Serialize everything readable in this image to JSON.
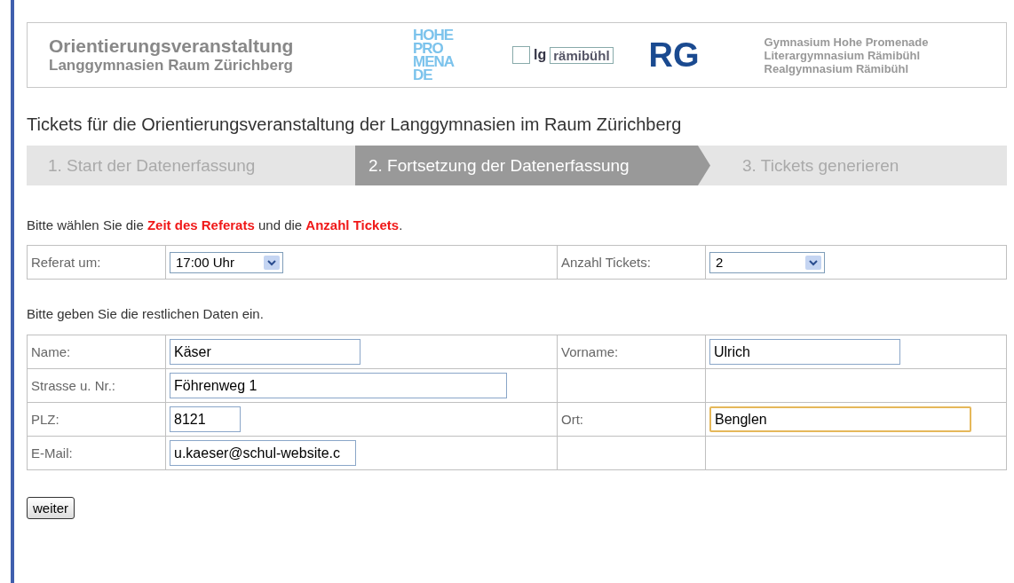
{
  "header": {
    "title": "Orientierungsveranstaltung",
    "subtitle": "Langgymnasien Raum Zürichberg",
    "logos": [
      {
        "kind": "stacked",
        "lines": [
          "HOHE",
          "PRO",
          "MENA",
          "DE"
        ]
      },
      {
        "kind": "boxed",
        "prefix": "lg",
        "name": "rämibühl"
      },
      {
        "kind": "initials",
        "text": "RG"
      }
    ],
    "schools": [
      "Gymnasium Hohe Promenade",
      "Literargymnasium Rämibühl",
      "Realgymnasium Rämibühl"
    ]
  },
  "page_title": "Tickets für die Orientierungsveranstaltung der Langgymnasien im Raum Zürichberg",
  "steps": [
    {
      "label": "1. Start der Datenerfassung",
      "selected": false
    },
    {
      "label": "2. Fortsetzung der Datenerfassung",
      "selected": true
    },
    {
      "label": "3. Tickets generieren",
      "selected": false
    }
  ],
  "instruction": "Bitte wählen Sie die **Zeit des Referats** und die **Anzahl Tickets**.",
  "selection": [
    {
      "label": "Referat um:",
      "value": "17:00 Uhr"
    },
    {
      "label": "Anzahl Tickets:",
      "value": "2"
    }
  ],
  "data_instruction": "Bitte geben Sie die restlichen Daten ein.",
  "data_rows": [
    [
      {
        "kind": "label",
        "text": "Name:"
      },
      {
        "kind": "input",
        "value": "Käser",
        "focused": false
      },
      {
        "kind": "label",
        "text": "Vorname:"
      },
      {
        "kind": "input",
        "value": "Ulrich",
        "focused": false
      }
    ],
    [
      {
        "kind": "label",
        "text": "Strasse u. Nr.:"
      },
      {
        "kind": "input",
        "value": "Föhrenweg 1",
        "focused": false
      },
      {
        "kind": "empty"
      },
      {
        "kind": "empty"
      }
    ],
    [
      {
        "kind": "label",
        "text": "PLZ:"
      },
      {
        "kind": "input",
        "value": "8121",
        "focused": false
      },
      {
        "kind": "label",
        "text": "Ort:"
      },
      {
        "kind": "input",
        "value": "Benglen",
        "focused": true
      }
    ],
    [
      {
        "kind": "label",
        "text": "E-Mail:"
      },
      {
        "kind": "input",
        "value": "u.kaeser@schul-website.c",
        "focused": false
      },
      {
        "kind": "empty"
      },
      {
        "kind": "empty"
      }
    ]
  ],
  "submit": "weiter"
}
